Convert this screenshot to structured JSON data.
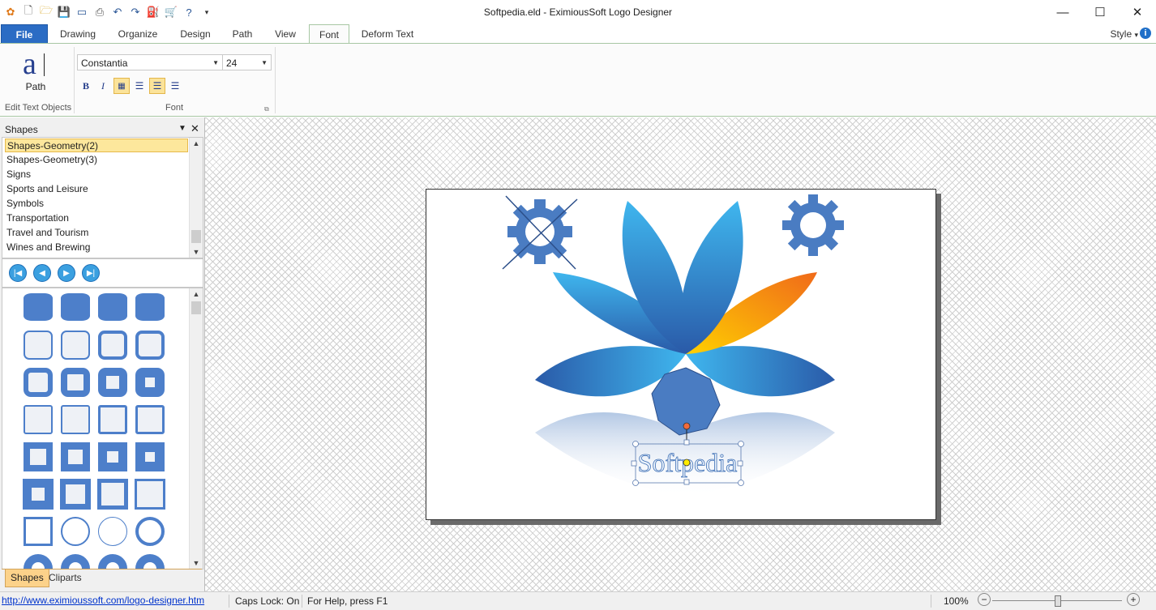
{
  "window": {
    "title": "Softpedia.eld - EximiousSoft Logo Designer",
    "minimize": "—",
    "maximize": "☐",
    "close": "✕"
  },
  "quick_access": [
    "app-logo-icon",
    "new-icon",
    "open-icon",
    "save-icon",
    "view-icon",
    "print-icon",
    "undo-icon",
    "redo-icon",
    "paint-icon",
    "cart-icon",
    "help-icon",
    "customize-icon"
  ],
  "tabs": {
    "file": "File",
    "items": [
      "Drawing",
      "Organize",
      "Design",
      "Path",
      "View",
      "Font",
      "Deform Text"
    ],
    "active": "Font",
    "style_label": "Style",
    "style_arrow": "▾"
  },
  "ribbon": {
    "path_button": "Path",
    "group_edit": "Edit Text Objects",
    "group_font": "Font",
    "font_name": "Constantia",
    "font_size": "24",
    "bold": "B",
    "italic": "I"
  },
  "panel": {
    "title": "Shapes",
    "categories": [
      "Shapes-Geometry(2)",
      "Shapes-Geometry(3)",
      "Signs",
      "Sports and Leisure",
      "Symbols",
      "Transportation",
      "Travel and Tourism",
      "Wines and Brewing"
    ],
    "selected": "Shapes-Geometry(2)",
    "tab_shapes": "Shapes",
    "tab_cliparts": "Cliparts"
  },
  "canvas": {
    "logo_text": "Softpedia",
    "colors": {
      "petal_blue": "#2a8fd8",
      "petal_dark": "#2a5aa8",
      "petal_orange": "#f7a21a",
      "gear": "#4a7cc2"
    }
  },
  "status": {
    "link": "http://www.eximioussoft.com/logo-designer.htm",
    "caps": "Caps Lock: On",
    "help": "For Help, press F1",
    "zoom": "100%",
    "zoom_minus": "−",
    "zoom_plus": "+"
  }
}
